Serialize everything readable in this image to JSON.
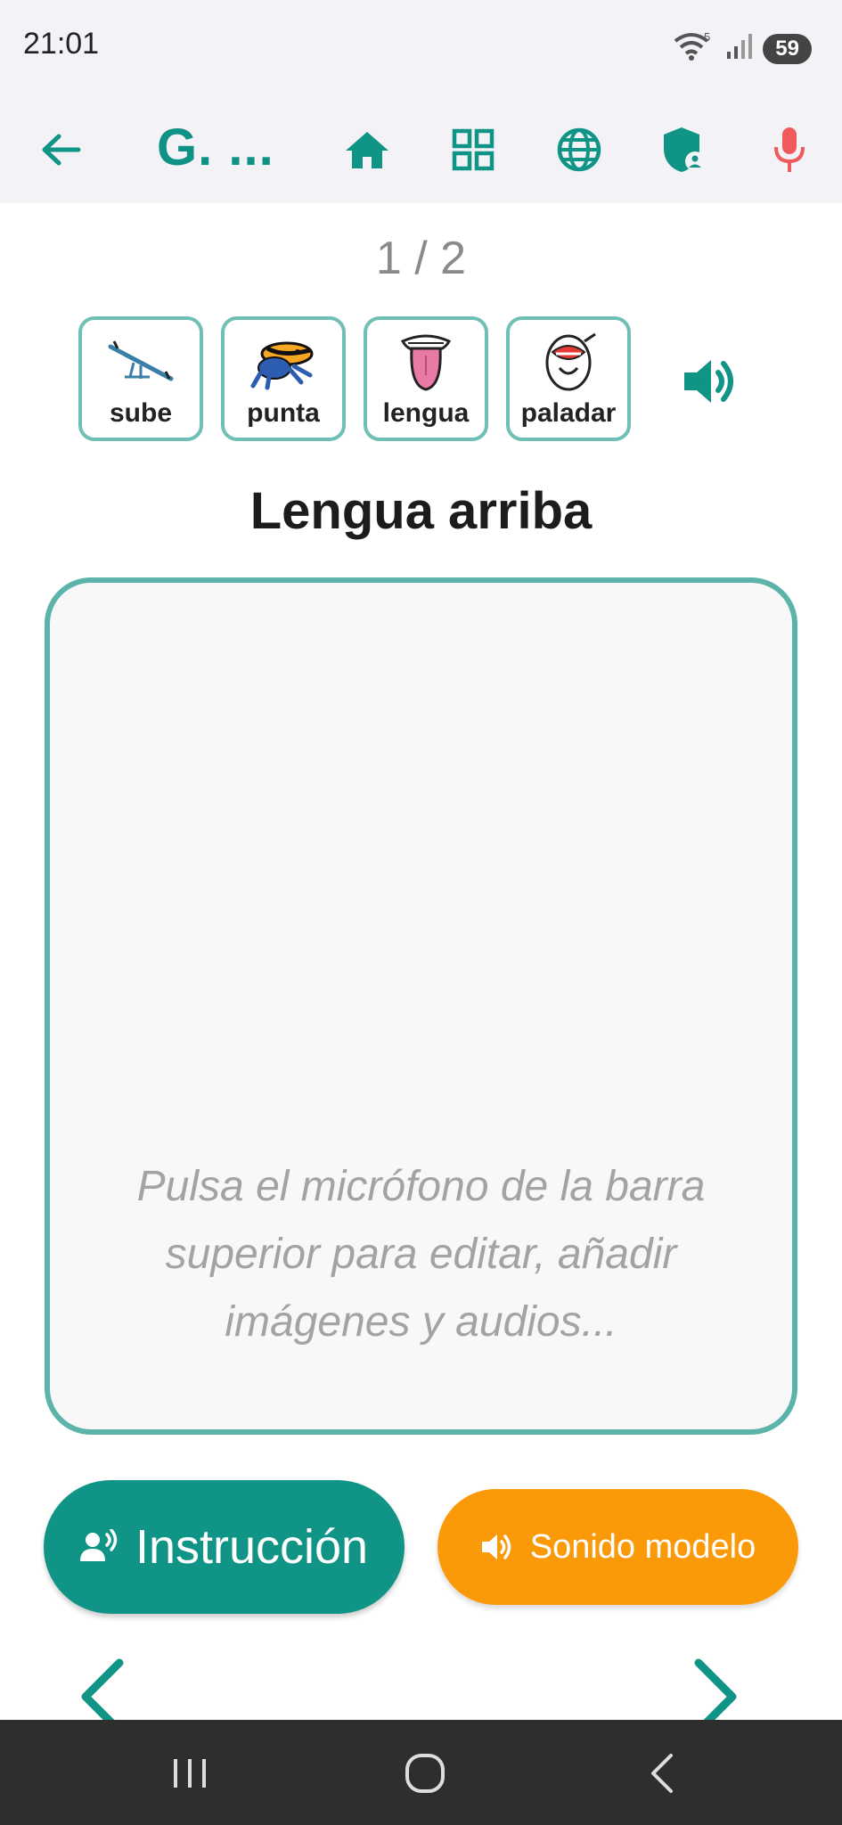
{
  "status": {
    "time": "21:01",
    "battery": "59",
    "wifi_badge": "5"
  },
  "appbar": {
    "title": "G. ..."
  },
  "pager": {
    "text": "1 / 2"
  },
  "cards": [
    {
      "label": "sube",
      "icon": "seesaw-icon"
    },
    {
      "label": "punta",
      "icon": "frog-icon"
    },
    {
      "label": "lengua",
      "icon": "tongue-icon"
    },
    {
      "label": "paladar",
      "icon": "palate-icon"
    }
  ],
  "heading": "Lengua arriba",
  "note": {
    "line1": "Pulsa el micrófono de la barra",
    "line2": "superior para editar, añadir",
    "line3": "imágenes y audios..."
  },
  "buttons": {
    "instruction": "Instrucción",
    "model_sound": "Sonido modelo"
  },
  "colors": {
    "teal": "#109486",
    "orange": "#fb9a08",
    "mic_red": "#f05a5a",
    "box_border": "#5bb3aa"
  }
}
